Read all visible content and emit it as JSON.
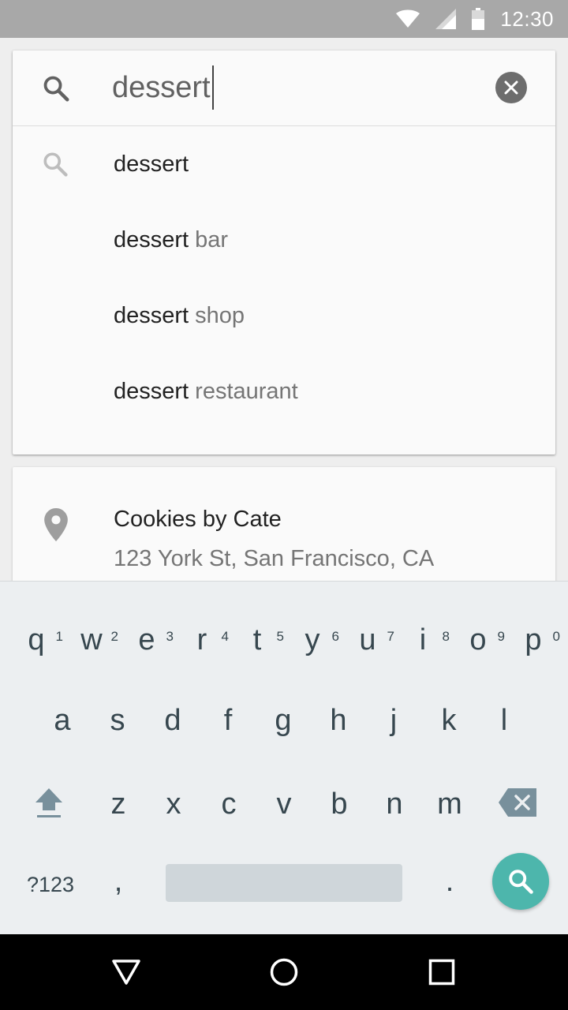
{
  "status_bar": {
    "time": "12:30",
    "icons": [
      "wifi-icon",
      "cell-signal-icon",
      "battery-icon"
    ]
  },
  "search": {
    "query": "dessert",
    "icon": "search-icon",
    "clear_icon": "clear-icon"
  },
  "suggestions": [
    {
      "prefix": "dessert",
      "suffix": ""
    },
    {
      "prefix": "dessert",
      "suffix": " bar"
    },
    {
      "prefix": "dessert",
      "suffix": " shop"
    },
    {
      "prefix": "dessert",
      "suffix": " restaurant"
    }
  ],
  "place": {
    "name": "Cookies by Cate",
    "address": "123 York St, San Francisco, CA",
    "icon": "location-pin-icon"
  },
  "keyboard": {
    "row1": [
      {
        "k": "q",
        "h": "1"
      },
      {
        "k": "w",
        "h": "2"
      },
      {
        "k": "e",
        "h": "3"
      },
      {
        "k": "r",
        "h": "4"
      },
      {
        "k": "t",
        "h": "5"
      },
      {
        "k": "y",
        "h": "6"
      },
      {
        "k": "u",
        "h": "7"
      },
      {
        "k": "i",
        "h": "8"
      },
      {
        "k": "o",
        "h": "9"
      },
      {
        "k": "p",
        "h": "0"
      }
    ],
    "row2": [
      "a",
      "s",
      "d",
      "f",
      "g",
      "h",
      "j",
      "k",
      "l"
    ],
    "row3": [
      "z",
      "x",
      "c",
      "v",
      "b",
      "n",
      "m"
    ],
    "symbols_label": "?123",
    "comma": ",",
    "period": ".",
    "accent_color": "#4db6ac"
  },
  "nav_bar": {
    "icons": [
      "back-icon",
      "home-icon",
      "recents-icon"
    ]
  }
}
